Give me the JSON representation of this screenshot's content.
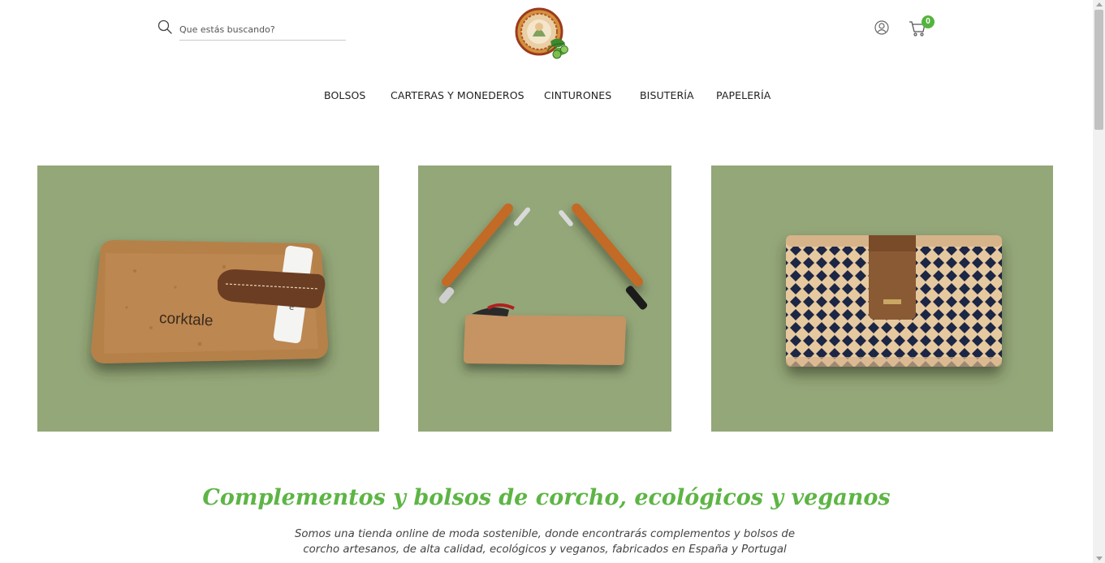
{
  "header": {
    "search": {
      "placeholder": "Que estás buscando?",
      "icon": "search-icon"
    },
    "logo": {
      "icon": "logo-icon"
    },
    "account": {
      "icon": "user-icon"
    },
    "cart": {
      "icon": "cart-icon",
      "count": "0",
      "badge_color": "#55b43f"
    }
  },
  "nav": {
    "items": [
      {
        "label": "BOLSOS"
      },
      {
        "label": "CARTERAS Y MONEDEROS"
      },
      {
        "label": "CINTURONES"
      },
      {
        "label": "BISUTERÍA"
      },
      {
        "label": "PAPELERÍA"
      }
    ]
  },
  "banners": [
    {
      "product_text": "corktale",
      "background": "#94a779"
    },
    {
      "background": "#94a779"
    },
    {
      "background": "#94a779"
    }
  ],
  "content": {
    "headline": "Complementos y bolsos de corcho, ecológicos y veganos",
    "intro_line1": "Somos una tienda online de moda sostenible, donde encontrarás complementos y bolsos de",
    "intro_line2": "corcho artesanos, de alta calidad, ecológicos y veganos, fabricados en España y Portugal"
  },
  "colors": {
    "accent": "#5db545",
    "banner_bg": "#94a779",
    "text": "#222222"
  }
}
